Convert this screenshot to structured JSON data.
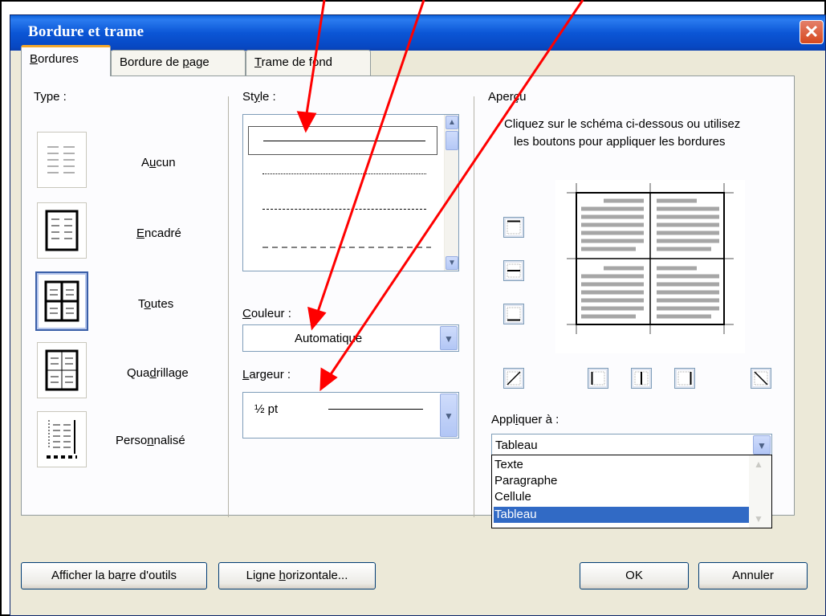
{
  "dialog": {
    "title": "Bordure et trame",
    "close_glyph": "✕"
  },
  "tabs": [
    {
      "label_pre": "",
      "label_key": "B",
      "label_post": "ordures"
    },
    {
      "label_pre": "Bordure de ",
      "label_key": "p",
      "label_post": "age"
    },
    {
      "label_pre": "",
      "label_key": "T",
      "label_post": "rame de fond"
    }
  ],
  "type_section": {
    "label": "Type :",
    "options": [
      {
        "pre": "A",
        "key": "u",
        "post": "cun"
      },
      {
        "pre": "",
        "key": "E",
        "post": "ncadré"
      },
      {
        "pre": "T",
        "key": "o",
        "post": "utes"
      },
      {
        "pre": "Qua",
        "key": "d",
        "post": "rillage"
      },
      {
        "pre": "Perso",
        "key": "n",
        "post": "nalisé"
      }
    ]
  },
  "style_section": {
    "label_pre": "St",
    "label_key": "y",
    "label_post": "le :",
    "styles": [
      "solid",
      "dotted",
      "dashed",
      "long-dashed"
    ],
    "selected_index": 0
  },
  "color_section": {
    "label_pre": "",
    "label_key": "C",
    "label_post": "ouleur :",
    "value": "Automatique"
  },
  "width_section": {
    "label_pre": "",
    "label_key": "L",
    "label_post": "argeur :",
    "value": "½ pt"
  },
  "preview_section": {
    "label": "Aperçu",
    "hint_line1": "Cliquez sur le schéma ci-dessous ou utilisez",
    "hint_line2": "les boutons pour appliquer les bordures"
  },
  "apply_section": {
    "label_pre": "Appl",
    "label_key": "i",
    "label_post": "quer à :",
    "value": "Tableau",
    "options": [
      "Texte",
      "Paragraphe",
      "Cellule",
      "Tableau"
    ],
    "selected_index": 3
  },
  "buttons": {
    "toolbar_pre": "Afficher la ba",
    "toolbar_key": "r",
    "toolbar_post": "re d'outils",
    "hline_pre": "Ligne ",
    "hline_key": "h",
    "hline_post": "orizontale...",
    "ok": "OK",
    "cancel": "Annuler"
  },
  "colors": {
    "title_bar": "#0b56d6",
    "dialog_bg": "#ece9d8",
    "selection": "#316ac5",
    "arrow": "#ff0000"
  }
}
